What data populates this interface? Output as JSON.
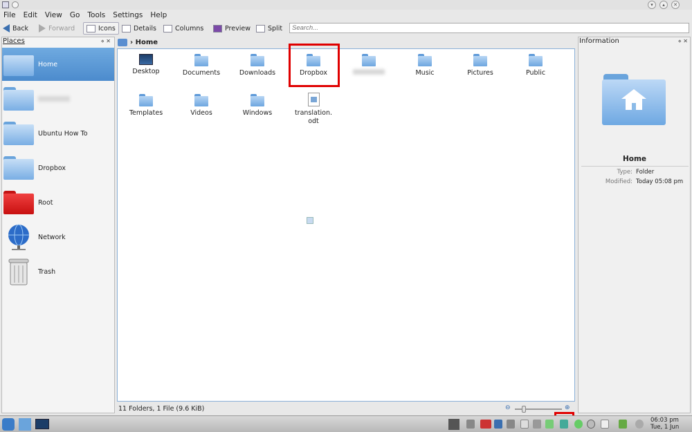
{
  "menu": [
    "File",
    "Edit",
    "View",
    "Go",
    "Tools",
    "Settings",
    "Help"
  ],
  "toolbar": {
    "back": "Back",
    "forward": "Forward",
    "icons": "Icons",
    "details": "Details",
    "columns": "Columns",
    "preview": "Preview",
    "split": "Split",
    "search_placeholder": "Search..."
  },
  "places": {
    "title": "Places",
    "items": [
      "Home",
      "",
      "Ubuntu How To",
      "Dropbox",
      "Root",
      "Network",
      "Trash"
    ]
  },
  "breadcrumb": "Home",
  "files": [
    {
      "name": "Desktop",
      "icon": "desktop-icon"
    },
    {
      "name": "Documents",
      "icon": "folder-icon"
    },
    {
      "name": "Downloads",
      "icon": "folder-icon"
    },
    {
      "name": "Dropbox",
      "icon": "folder-icon"
    },
    {
      "name": "",
      "icon": "folder-icon"
    },
    {
      "name": "Music",
      "icon": "folder-icon"
    },
    {
      "name": "Pictures",
      "icon": "folder-icon"
    },
    {
      "name": "Public",
      "icon": "folder-icon"
    },
    {
      "name": "Templates",
      "icon": "folder-icon"
    },
    {
      "name": "Videos",
      "icon": "folder-icon"
    },
    {
      "name": "Windows",
      "icon": "folder-icon"
    },
    {
      "name": "translation.\nodt",
      "icon": "document-icon"
    }
  ],
  "status": "11 Folders, 1 File (9.6 KiB)",
  "info": {
    "title": "Information",
    "name": "Home",
    "type_label": "Type:",
    "type_value": "Folder",
    "modified_label": "Modified:",
    "modified_value": "Today 05:08 pm"
  },
  "clock": {
    "time": "06:03 pm",
    "date": "Tue, 1 Jun"
  },
  "colors": {
    "selection": "#5b9ad6",
    "highlight": "#e00000"
  }
}
